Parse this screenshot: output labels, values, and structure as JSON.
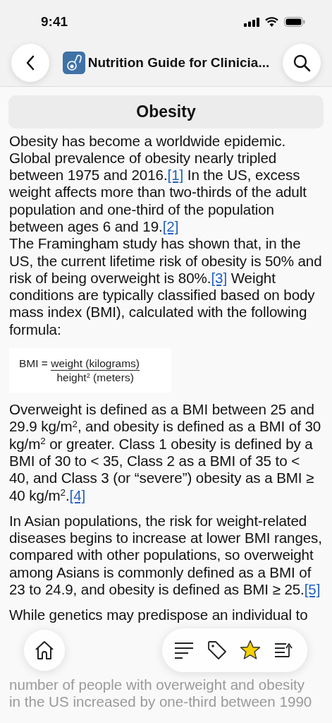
{
  "status_bar": {
    "time": "9:41"
  },
  "nav": {
    "title": "Nutrition Guide for Clinicia..."
  },
  "section": {
    "title": "Obesity"
  },
  "paragraphs": [
    {
      "kind": "text",
      "segments": [
        {
          "text": "Obesity has become a worldwide epidemic. Global prevalence of obesity nearly tripled between 1975 and 2016."
        },
        {
          "ref": "[1]"
        },
        {
          "text": " In the US, excess weight affects more than two-thirds of the adult population and one-third of the population between ages 6 and 19."
        },
        {
          "ref": "[2]"
        }
      ]
    },
    {
      "kind": "continuation",
      "segments": [
        {
          "text": "The Framingham study has shown that, in the US, the current lifetime risk of obesity is 50% and risk of being overweight is 80%."
        },
        {
          "ref": "[3]"
        },
        {
          "text": " Weight conditions are typically classified based on body mass index (BMI), calculated with the following formula:"
        }
      ]
    },
    {
      "kind": "formula",
      "lhs": "BMI =",
      "numerator": "weight (kilograms)",
      "denominator": "height$^{2}$ (meters)"
    },
    {
      "kind": "text",
      "segments": [
        {
          "text": "Overweight is defined as a BMI between 25 and 29.9 kg/m$^{2}$, and obesity is defined as a BMI of 30 kg/m$^{2}$ or greater. Class 1 obesity is defined by a BMI of 30 to < 35, Class 2 as a BMI of 35 to < 40, and Class 3 (or “severe”) obesity as a BMI ≥ 40 kg/m$^{2}$."
        },
        {
          "ref": "[4]"
        }
      ]
    },
    {
      "kind": "text",
      "segments": [
        {
          "text": "In Asian populations, the risk for weight-related diseases begins to increase at lower BMI ranges, compared with other populations, so overweight among Asians is commonly defined as a BMI of 23 to 24.9, and obesity is defined as BMI ≥ 25."
        },
        {
          "ref": "[5]"
        }
      ]
    },
    {
      "kind": "covered",
      "above": "While genetics may predispose an individual to",
      "below": [
        "number of people with overweight and obesity",
        "in the US increased by one-third between 1990"
      ]
    }
  ],
  "toolbar": {
    "favorited": true
  }
}
